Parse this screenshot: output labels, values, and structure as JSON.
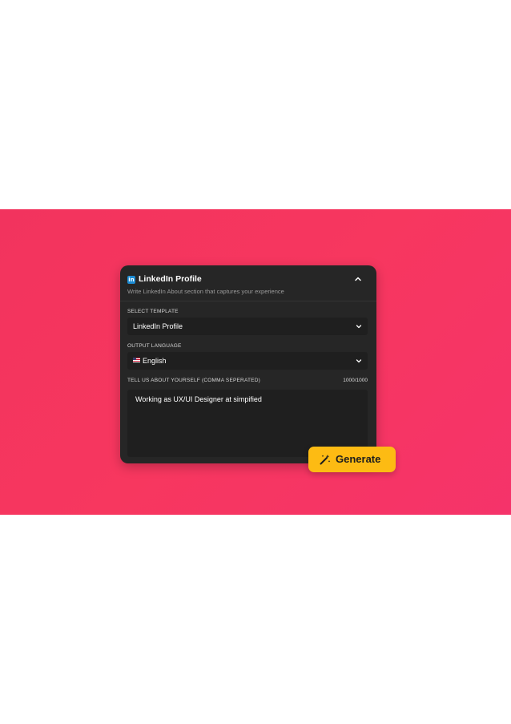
{
  "header": {
    "icon": "linkedin-icon",
    "title": "LinkedIn Profile",
    "subtitle": "Write LinkedIn About section that captures your experience",
    "collapse_icon": "chevron-up-icon"
  },
  "template": {
    "label": "SELECT TEMPLATE",
    "value": "LinkedIn Profile",
    "icon": "chevron-down-icon"
  },
  "language": {
    "label": "OUTPUT LANGUAGE",
    "value": "English",
    "flag_icon": "us-flag-icon",
    "icon": "chevron-down-icon"
  },
  "about": {
    "label": "TELL US ABOUT YOURSELF (COMMA SEPERATED)",
    "counter": "1000/1000",
    "value": "Working as UX/UI Designer at simpified"
  },
  "generate": {
    "label": "Generate",
    "icon": "magic-wand-icon"
  },
  "colors": {
    "background_accent": "#f5345f",
    "card": "#262626",
    "button": "#fdbb13",
    "linkedin": "#1d8bd2"
  }
}
